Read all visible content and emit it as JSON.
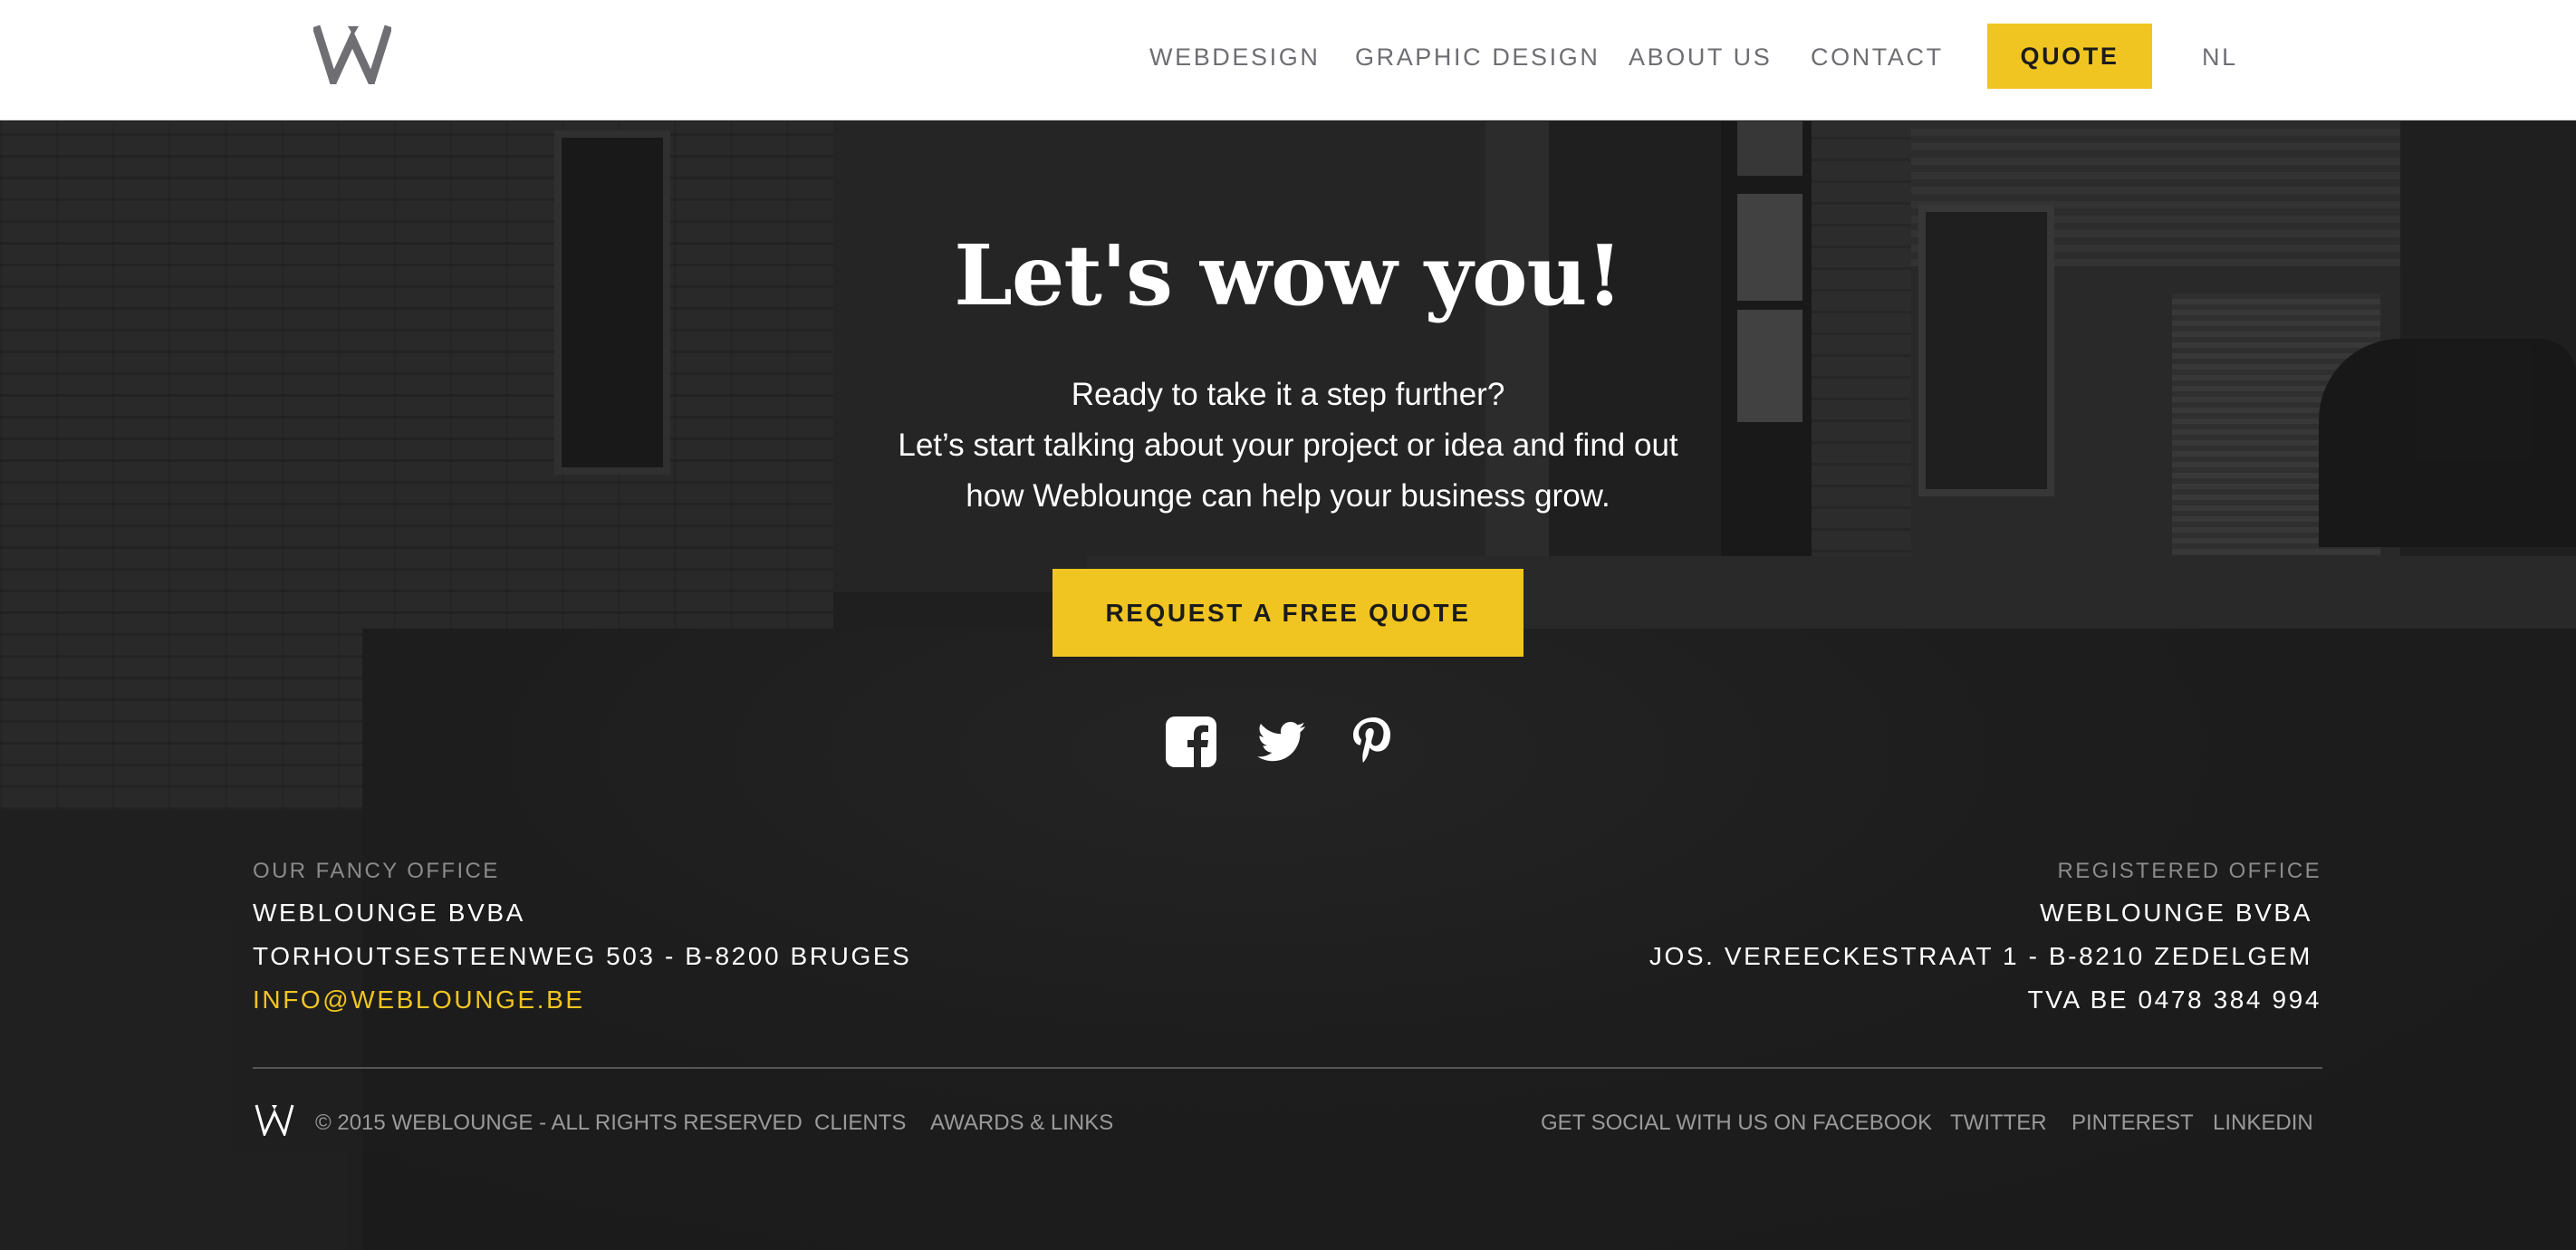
{
  "header": {
    "nav": {
      "webdesign": "WEBDESIGN",
      "graphic_design": "GRAPHIC DESIGN",
      "about_us": "ABOUT US",
      "contact": "CONTACT",
      "quote": "QUOTE",
      "language": "NL"
    }
  },
  "hero": {
    "headline": "Let's wow you!",
    "intro_lines": [
      "Ready to take it a step further?",
      "Let’s start talking about your project or idea and find out",
      "how Weblounge can help your business grow."
    ],
    "cta_label": "REQUEST A FREE QUOTE",
    "social_icons": [
      "facebook-icon",
      "twitter-icon",
      "pinterest-icon"
    ]
  },
  "offices": {
    "fancy": {
      "label": "OUR FANCY OFFICE",
      "name": "WEBLOUNGE BVBA",
      "address": "TORHOUTSESTEENWEG 503 - B-8200 BRUGES",
      "email": "INFO@WEBLOUNGE.BE"
    },
    "registered": {
      "label": "REGISTERED OFFICE",
      "name": "WEBLOUNGE BVBA",
      "address": "JOS. VEREECKESTRAAT 1 - B-8210 ZEDELGEM",
      "vat": "TVA BE 0478 384 994"
    }
  },
  "footer": {
    "copyright": "© 2015 WEBLOUNGE - ALL RIGHTS RESERVED",
    "links": {
      "clients": "CLIENTS",
      "awards": "AWARDS & LINKS"
    },
    "social_links": {
      "facebook": "GET SOCIAL WITH US ON FACEBOOK",
      "twitter": "TWITTER",
      "pinterest": "PINTEREST",
      "linkedin": "LINKEDIN"
    }
  },
  "colors": {
    "accent": "#f1c521",
    "header_bg": "#ffffff",
    "nav_text": "#6e6e73",
    "hero_bg": "#262626",
    "muted_text": "#8b8b8b"
  }
}
